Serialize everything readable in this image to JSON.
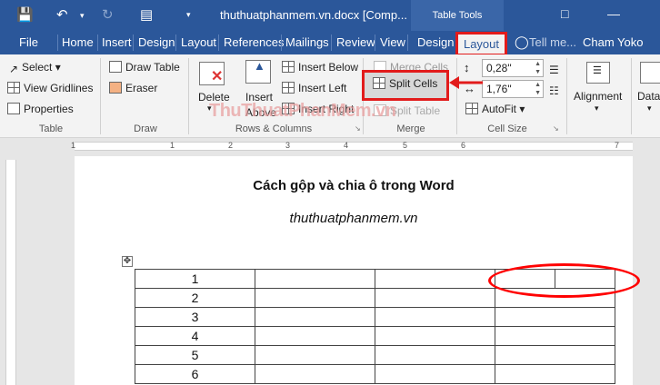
{
  "title_bar": {
    "document_title": "thuthuatphanmem.vn.docx [Comp...",
    "context_tab_group": "Table Tools"
  },
  "tabs": [
    "File",
    "Home",
    "Insert",
    "Design",
    "Layout",
    "References",
    "Mailings",
    "Review",
    "View",
    "Design",
    "Layout"
  ],
  "tell_me": "Tell me...",
  "user_name": "Cham Yoko",
  "ribbon": {
    "table_group": {
      "label": "Table",
      "select": "Select",
      "view_gridlines": "View Gridlines",
      "properties": "Properties"
    },
    "draw_group": {
      "label": "Draw",
      "draw_table": "Draw Table",
      "eraser": "Eraser"
    },
    "rows_columns_group": {
      "label": "Rows & Columns",
      "delete": "Delete",
      "insert_above_1": "Insert",
      "insert_above_2": "Above",
      "insert_below": "Insert Below",
      "insert_left": "Insert Left",
      "insert_right": "Insert Right"
    },
    "merge_group": {
      "label": "Merge",
      "merge_cells": "Merge Cells",
      "split_cells": "Split Cells",
      "split_table": "Split Table"
    },
    "cell_size_group": {
      "label": "Cell Size",
      "height": "0,28\"",
      "width": "1,76\"",
      "autofit": "AutoFit"
    },
    "alignment": "Alignment",
    "data": "Data"
  },
  "watermark": "ThuThuatPhanMem.vn",
  "ruler": {
    "marks": [
      "1",
      "1",
      "2",
      "3",
      "4",
      "5",
      "6",
      "7"
    ]
  },
  "document": {
    "heading": "Cách gộp và chia ô trong Word",
    "subheading": "thuthuatphanmem.vn",
    "rows": [
      "1",
      "2",
      "3",
      "4",
      "5",
      "6"
    ]
  },
  "colors": {
    "word_blue": "#2b579a",
    "highlight_red": "#e21b1b"
  }
}
